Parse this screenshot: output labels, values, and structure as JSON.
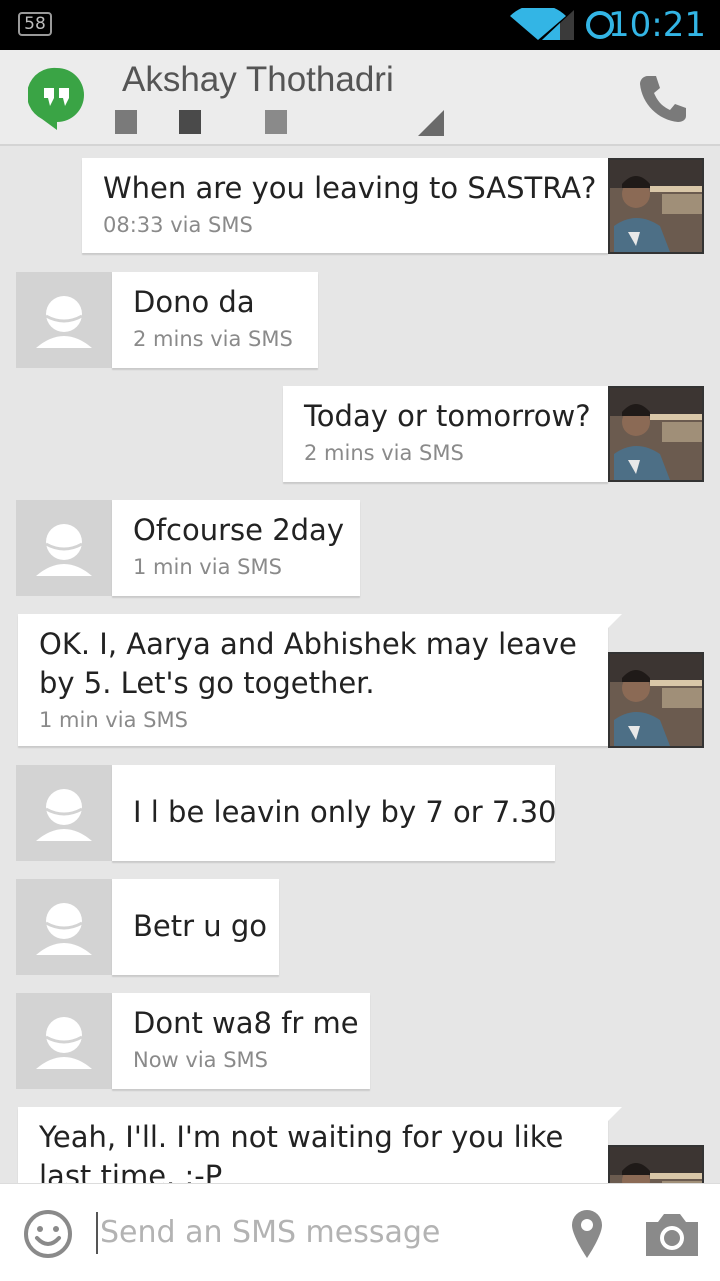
{
  "status_bar": {
    "notification_count": "58",
    "time": "10:21",
    "icons": [
      "wifi-icon",
      "signal-icon",
      "sync-icon"
    ]
  },
  "header": {
    "contact_name": "Akshay Thothadri",
    "icons": [
      "hangouts-logo-icon",
      "phone-icon",
      "dropdown-triangle-icon"
    ]
  },
  "messages": [
    {
      "sender": "me",
      "text": "When are you leaving to SASTRA?",
      "meta": "08:33 via SMS"
    },
    {
      "sender": "contact",
      "text": "Dono da",
      "meta": "2 mins via SMS"
    },
    {
      "sender": "me",
      "text": "Today or tomorrow?",
      "meta": "2 mins via SMS"
    },
    {
      "sender": "contact",
      "text": "Ofcourse 2day",
      "meta": "1 min via SMS"
    },
    {
      "sender": "me",
      "text_line1": "OK. I, Aarya and Abhishek may leave",
      "text_line2": "by 5. Let's go together.",
      "meta": "1 min via SMS"
    },
    {
      "sender": "contact",
      "text": "I l be leavin only by 7 or 7.30"
    },
    {
      "sender": "contact",
      "text": "Betr u go"
    },
    {
      "sender": "contact",
      "text": "Dont wa8 fr me",
      "meta": "Now via SMS"
    },
    {
      "sender": "me",
      "text_line1": "Yeah, I'll. I'm not waiting for you like",
      "text_line2": "last time. :-P"
    }
  ],
  "compose": {
    "placeholder": "Send an SMS message",
    "icons": [
      "emoji-icon",
      "location-icon",
      "camera-icon"
    ]
  },
  "colors": {
    "accent": "#33b5e5",
    "hangouts_green": "#3aa445",
    "background": "#e6e6e6",
    "bubble": "#ffffff"
  }
}
